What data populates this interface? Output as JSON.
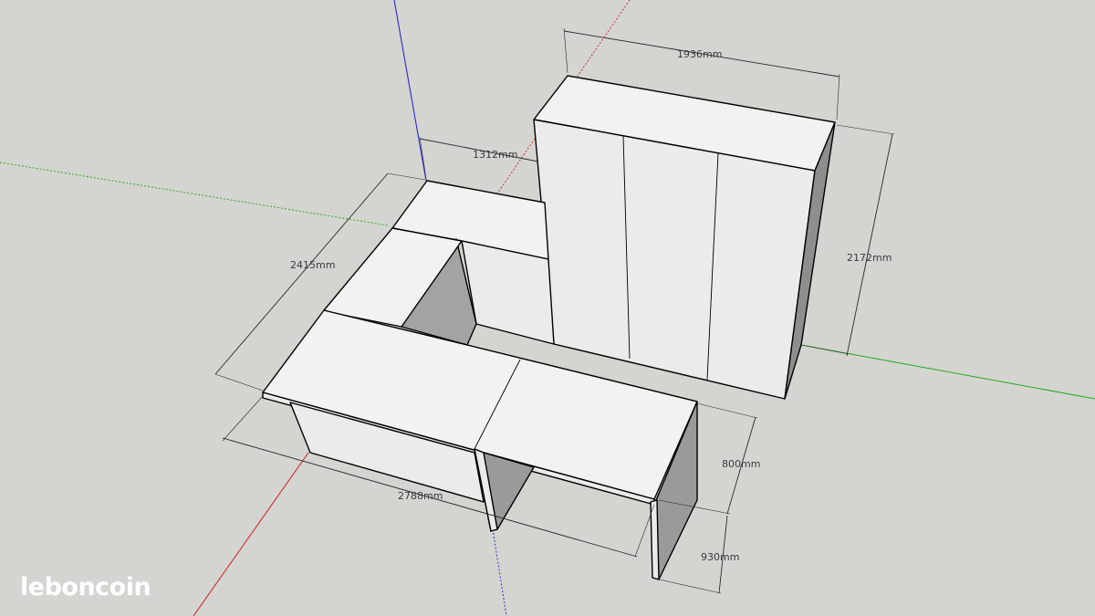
{
  "dimensions": {
    "wardrobe_width": "1936mm",
    "wardrobe_height": "2172mm",
    "gap_to_wardrobe": "1312mm",
    "desk_depth_side": "2415mm",
    "desk_length": "2788mm",
    "desk_height": "800mm",
    "leg_height": "930mm"
  },
  "watermark": {
    "brand": "leboncoin"
  },
  "colors": {
    "background": "#d4d4d0",
    "axis_blue": "#2222cc",
    "axis_red": "#cc2222",
    "axis_green": "#22aa22"
  }
}
